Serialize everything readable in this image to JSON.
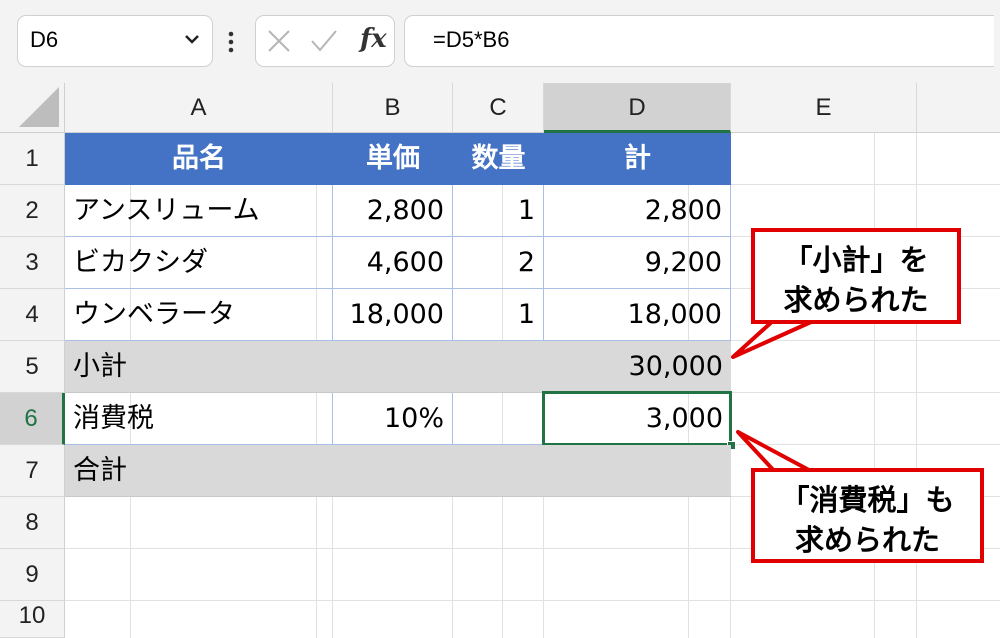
{
  "formula_bar": {
    "name_box": "D6",
    "formula": "=D5*B6",
    "fx_label": "fx"
  },
  "columns": [
    "A",
    "B",
    "C",
    "D",
    "E"
  ],
  "rows": [
    "1",
    "2",
    "3",
    "4",
    "5",
    "6",
    "7",
    "8",
    "9",
    "10"
  ],
  "table": {
    "header": [
      "品名",
      "単価",
      "数量",
      "計"
    ],
    "items": [
      {
        "name": "アンスリューム",
        "price": "2,800",
        "qty": "1",
        "total": "2,800"
      },
      {
        "name": "ビカクシダ",
        "price": "4,600",
        "qty": "2",
        "total": "9,200"
      },
      {
        "name": "ウンベラータ",
        "price": "18,000",
        "qty": "1",
        "total": "18,000"
      }
    ],
    "subtotal": {
      "label": "小計",
      "value": "30,000"
    },
    "tax": {
      "label": "消費税",
      "rate": "10%",
      "value": "3,000"
    },
    "grand_total": {
      "label": "合計",
      "value": ""
    }
  },
  "callouts": {
    "subtotal_line1": "「小計」を",
    "subtotal_line2": "求められた",
    "tax_line1": "「消費税」も",
    "tax_line2": "求められた"
  },
  "colors": {
    "header_blue": "#4472c4",
    "excel_green": "#217346",
    "callout_red": "#e00000",
    "summary_grey": "#d9d9d9"
  }
}
